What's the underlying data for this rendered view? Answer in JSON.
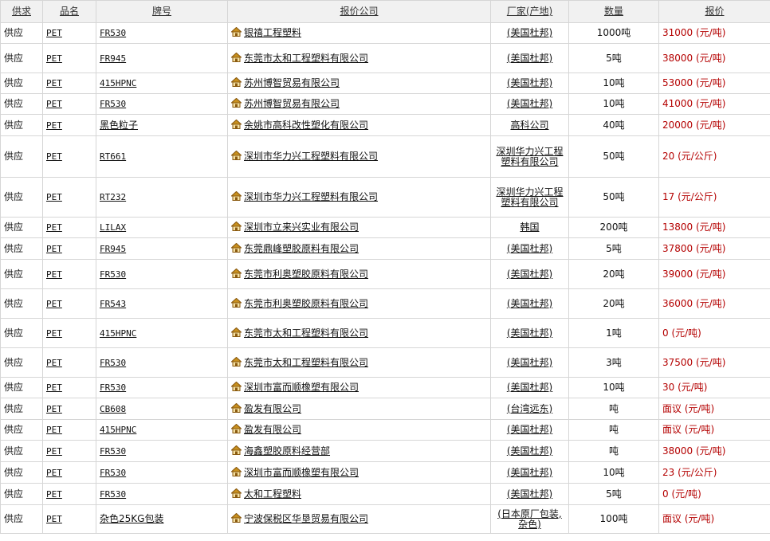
{
  "headers": {
    "type": "供求",
    "name": "品名",
    "grade": "牌号",
    "company": "报价公司",
    "maker": "厂家(产地)",
    "qty": "数量",
    "price": "报价"
  },
  "rows": [
    {
      "type": "供应",
      "name": "PET",
      "grade": "FR530",
      "company": "银禧工程塑料",
      "maker": "(美国杜邦)",
      "qty": "1000吨",
      "price": "31000 (元/吨)"
    },
    {
      "type": "供应",
      "name": "PET",
      "grade": "FR945",
      "company": "东莞市太和工程塑料有限公司",
      "maker": "(美国杜邦)",
      "qty": "5吨",
      "price": "38000 (元/吨)"
    },
    {
      "type": "供应",
      "name": "PET",
      "grade": "415HPNC",
      "company": "苏州博智贸易有限公司",
      "maker": "(美国杜邦)",
      "qty": "10吨",
      "price": "53000 (元/吨)"
    },
    {
      "type": "供应",
      "name": "PET",
      "grade": "FR530",
      "company": "苏州博智贸易有限公司",
      "maker": "(美国杜邦)",
      "qty": "10吨",
      "price": "41000 (元/吨)"
    },
    {
      "type": "供应",
      "name": "PET",
      "grade": "黑色粒子",
      "company": "余姚市高科改性塑化有限公司",
      "maker": "高科公司",
      "qty": "40吨",
      "price": "20000 (元/吨)"
    },
    {
      "type": "供应",
      "name": "PET",
      "grade": "RT661",
      "company": "深圳市华力兴工程塑料有限公司",
      "maker": "深圳华力兴工程塑料有限公司",
      "qty": "50吨",
      "price": "20 (元/公斤)"
    },
    {
      "type": "供应",
      "name": "PET",
      "grade": "RT232",
      "company": "深圳市华力兴工程塑料有限公司",
      "maker": "深圳华力兴工程塑料有限公司",
      "qty": "50吨",
      "price": "17 (元/公斤)"
    },
    {
      "type": "供应",
      "name": "PET",
      "grade": "LILAX",
      "company": "深圳市立来兴实业有限公司",
      "maker": "韩国",
      "qty": "200吨",
      "price": "13800 (元/吨)"
    },
    {
      "type": "供应",
      "name": "PET",
      "grade": "FR945",
      "company": "东莞鼎峰塑胶原料有限公司",
      "maker": "(美国杜邦)",
      "qty": "5吨",
      "price": "37800 (元/吨)"
    },
    {
      "type": "供应",
      "name": "PET",
      "grade": "FR530",
      "company": "东莞市利奥塑胶原料有限公司",
      "maker": "(美国杜邦)",
      "qty": "20吨",
      "price": "39000 (元/吨)"
    },
    {
      "type": "供应",
      "name": "PET",
      "grade": "FR543",
      "company": "东莞市利奥塑胶原料有限公司",
      "maker": "(美国杜邦)",
      "qty": "20吨",
      "price": "36000 (元/吨)"
    },
    {
      "type": "供应",
      "name": "PET",
      "grade": "415HPNC",
      "company": "东莞市太和工程塑料有限公司",
      "maker": "(美国杜邦)",
      "qty": "1吨",
      "price": "0 (元/吨)"
    },
    {
      "type": "供应",
      "name": "PET",
      "grade": "FR530",
      "company": "东莞市太和工程塑料有限公司",
      "maker": "(美国杜邦)",
      "qty": "3吨",
      "price": "37500 (元/吨)"
    },
    {
      "type": "供应",
      "name": "PET",
      "grade": "FR530",
      "company": "深圳市富而顺橡塑有限公司",
      "maker": "(美国杜邦)",
      "qty": "10吨",
      "price": "30 (元/吨)"
    },
    {
      "type": "供应",
      "name": "PET",
      "grade": "CB608",
      "company": "盈发有限公司",
      "maker": "(台湾远东)",
      "qty": "吨",
      "price": "面议 (元/吨)"
    },
    {
      "type": "供应",
      "name": "PET",
      "grade": "415HPNC",
      "company": "盈发有限公司",
      "maker": "(美国杜邦)",
      "qty": "吨",
      "price": "面议 (元/吨)"
    },
    {
      "type": "供应",
      "name": "PET",
      "grade": "FR530",
      "company": "海鑫塑胶原料经营部",
      "maker": "(美国杜邦)",
      "qty": "吨",
      "price": "38000 (元/吨)"
    },
    {
      "type": "供应",
      "name": "PET",
      "grade": "FR530",
      "company": "深圳市富而顺橡塑有限公司",
      "maker": "(美国杜邦)",
      "qty": "10吨",
      "price": "23 (元/公斤)"
    },
    {
      "type": "供应",
      "name": "PET",
      "grade": "FR530",
      "company": "太和工程塑料",
      "maker": "(美国杜邦)",
      "qty": "5吨",
      "price": "0 (元/吨)"
    },
    {
      "type": "供应",
      "name": "PET",
      "grade": "杂色25KG包装",
      "company": "宁波保税区华垦贸易有限公司",
      "maker": "(日本原厂包装,杂色)",
      "qty": "100吨",
      "price": "面议 (元/吨)"
    }
  ],
  "colors": {
    "price": "#b40000",
    "header_bg": "#f1f1f1",
    "border": "#d6d6d6",
    "house_roof": "#c8901e"
  },
  "icon": "house-icon"
}
